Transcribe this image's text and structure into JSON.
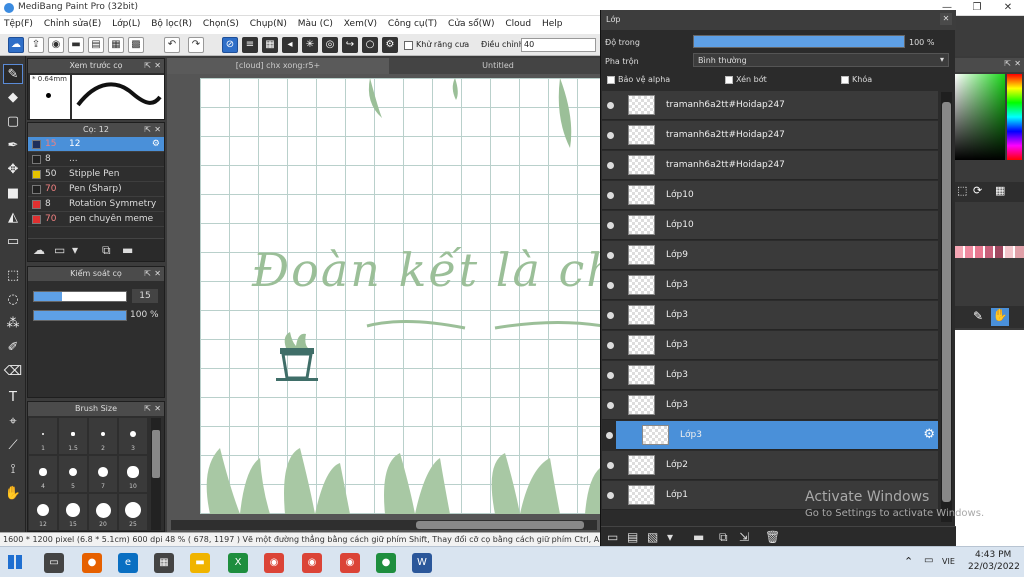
{
  "window": {
    "title": "MediBang Paint Pro (32bit)",
    "minimize_glyph": "—",
    "maximize_glyph": "❐",
    "close_glyph": "✕"
  },
  "menu": [
    "Tệp(F)",
    "Chỉnh sửa(E)",
    "Lớp(L)",
    "Bộ lọc(R)",
    "Chọn(S)",
    "Chụp(N)",
    "Màu (C)",
    "Xem(V)",
    "Công cụ(T)",
    "Cửa sổ(W)",
    "Cloud",
    "Help"
  ],
  "toolbar": {
    "antialias_label": "Khử răng cưa",
    "adjust_label": "Điều chỉnh",
    "adjust_value": "40"
  },
  "preview_panel": {
    "title": "Xem trước cọ",
    "size": "0.64mm"
  },
  "brush_panel": {
    "title": "Cọ: 12",
    "items": [
      {
        "num": "15",
        "name": "12",
        "color": "#1f2f5a",
        "selected": true
      },
      {
        "num": "8",
        "name": "...",
        "color": "#222222"
      },
      {
        "num": "50",
        "name": "Stipple Pen",
        "color": "#e6c200"
      },
      {
        "num": "70",
        "name": "Pen (Sharp)",
        "color": "#222222"
      },
      {
        "num": "8",
        "name": "Rotation Symmetry",
        "color": "#e03030"
      },
      {
        "num": "70",
        "name": "pen chuyên meme",
        "color": "#e03030"
      }
    ]
  },
  "control_panel": {
    "title": "Kiểm soát cọ",
    "size_value": "15",
    "opacity_value": "100 %",
    "size_fill": 0.3,
    "opacity_fill": 1.0
  },
  "brushsize_panel": {
    "title": "Brush Size",
    "labels": [
      "1",
      "1.5",
      "2",
      "3",
      "4",
      "5",
      "7",
      "10",
      "12",
      "15",
      "20",
      "25"
    ]
  },
  "document": {
    "tabs": [
      "[cloud] chx xong:r5+",
      "Untitled"
    ],
    "canvas_text": "Đoàn kết là chấp"
  },
  "status": {
    "text": "1600 * 1200 pixel   (6.8 * 5.1cm)   600 dpi   48 %   ( 678, 1197 )   Vẽ một đường thẳng bằng cách giữ phím Shift, Thay đổi cỡ cọ bằng cách giữ phím Ctrl, A"
  },
  "layer_panel": {
    "title": "Lớp",
    "opacity_label": "Độ trong",
    "opacity_value": "100 %",
    "opacity_fill": 1.0,
    "blend_label": "Pha trộn",
    "blend_value": "Bình thường",
    "protect_alpha": "Bảo vệ alpha",
    "clipping": "Xén bớt",
    "lock": "Khóa",
    "layers": [
      {
        "name": "tramanh6a2tt#Hoidap247",
        "selected": false
      },
      {
        "name": "tramanh6a2tt#Hoidap247",
        "selected": false
      },
      {
        "name": "tramanh6a2tt#Hoidap247",
        "selected": false
      },
      {
        "name": "Lớp10",
        "selected": false
      },
      {
        "name": "Lớp10",
        "selected": false
      },
      {
        "name": "Lớp9",
        "selected": false
      },
      {
        "name": "Lớp3",
        "selected": false
      },
      {
        "name": "Lớp3",
        "selected": false
      },
      {
        "name": "Lớp3",
        "selected": false
      },
      {
        "name": "Lớp3",
        "selected": false
      },
      {
        "name": "Lớp3",
        "selected": false
      },
      {
        "name": "Lớp3",
        "selected": true
      },
      {
        "name": "Lớp2",
        "selected": false
      },
      {
        "name": "Lớp1",
        "selected": false
      }
    ]
  },
  "watermark": {
    "line1": "Activate Windows",
    "line2": "Go to Settings to activate Windows."
  },
  "taskbar": {
    "time": "4:43 PM",
    "date": "22/03/2022",
    "lang": "VIE"
  },
  "colors": {
    "accent": "#4a90d9",
    "canvas_green": "#9bbf98"
  }
}
